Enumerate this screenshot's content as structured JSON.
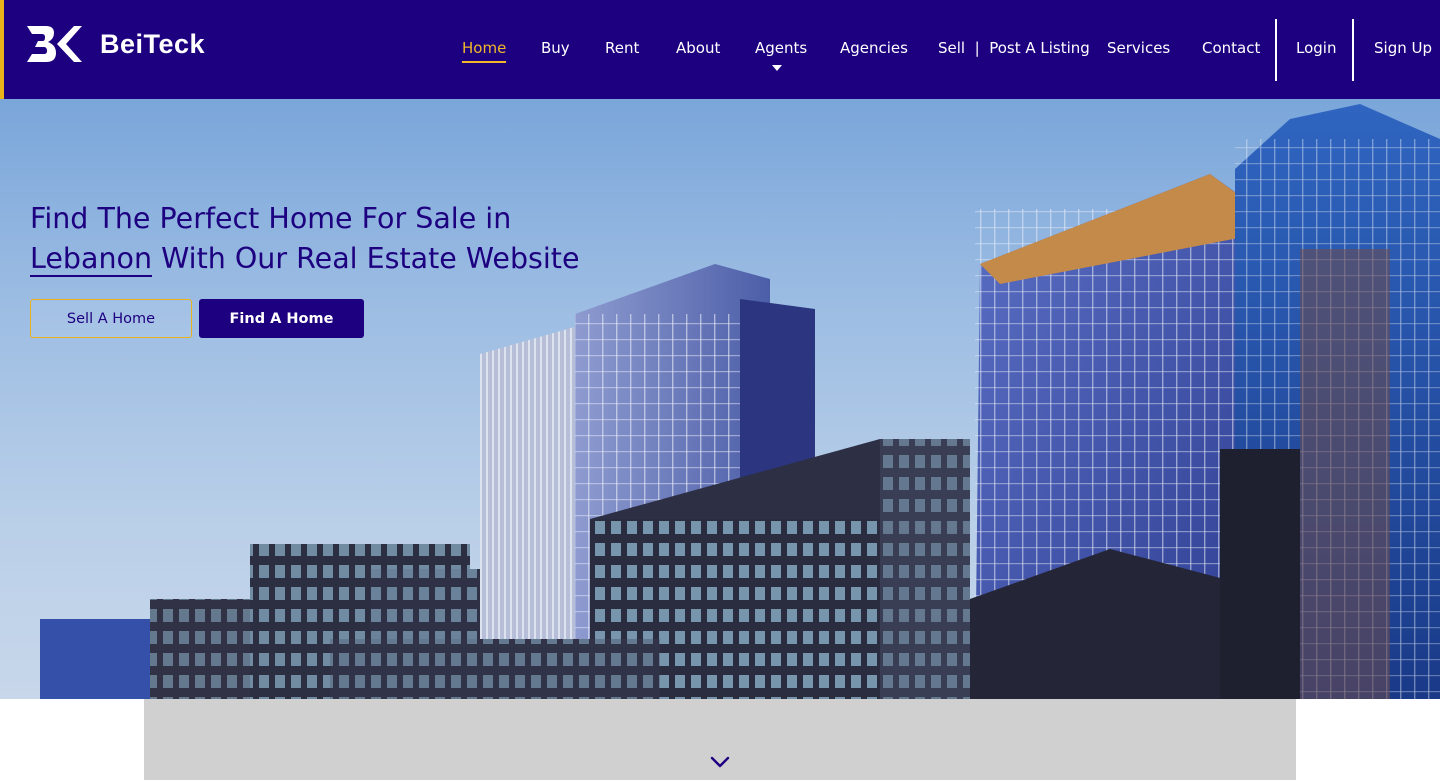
{
  "brand": {
    "name": "BeiTeck",
    "logo_icon": "bk-monogram-icon"
  },
  "colors": {
    "primary": "#1d0080",
    "accent": "#f2b829",
    "border_accent": "#e8b21b"
  },
  "nav": {
    "home": "Home",
    "buy": "Buy",
    "rent": "Rent",
    "about": "About",
    "agents": "Agents",
    "agencies": "Agencies",
    "sell_post": "Sell  |  Post A Listing",
    "services": "Services",
    "contact": "Contact",
    "login": "Login",
    "signup": "Sign Up",
    "active": "Home"
  },
  "hero": {
    "title_part1": "Find The Perfect Home For Sale in",
    "title_highlight": "Lebanon",
    "title_part2": "With Our Real Estate Website",
    "sell_button": "Sell A Home",
    "find_button": "Find A Home"
  },
  "scroll": {
    "icon": "chevron-down-icon"
  }
}
